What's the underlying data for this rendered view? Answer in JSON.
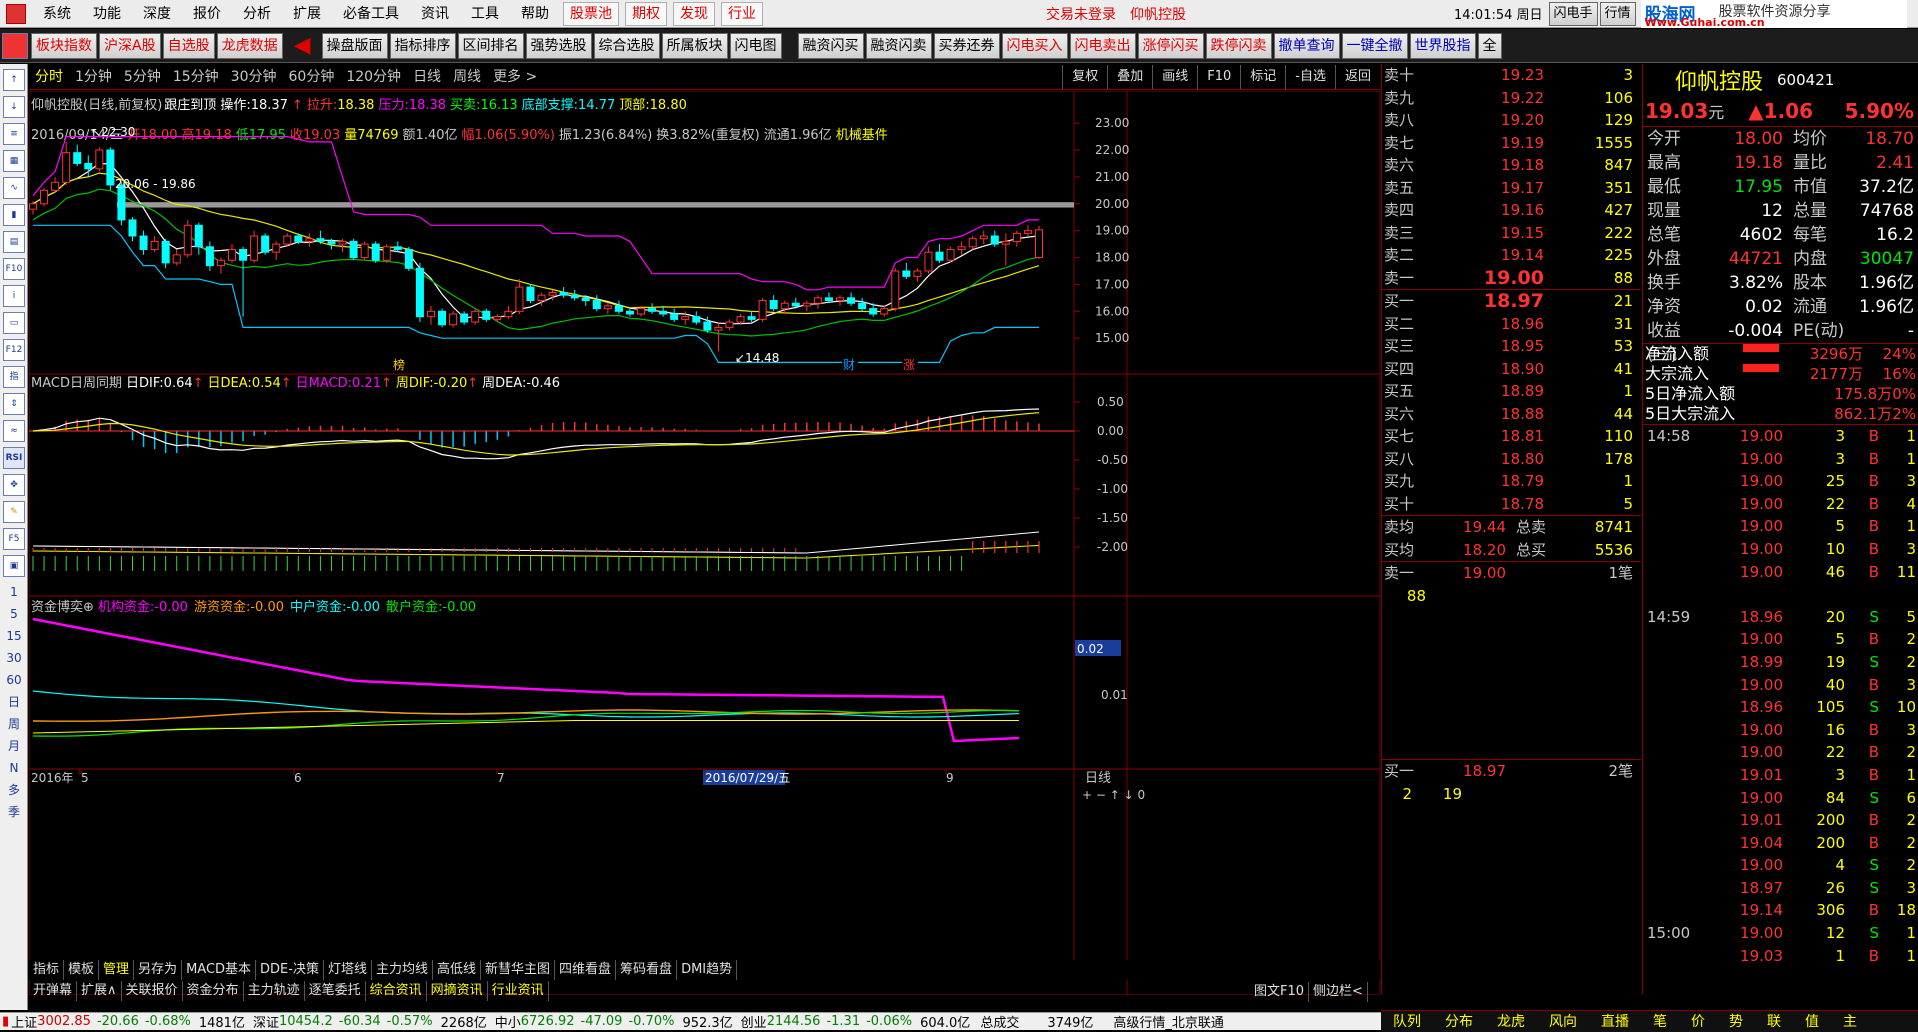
{
  "menu": {
    "items": [
      "系统",
      "功能",
      "深度",
      "报价",
      "分析",
      "扩展",
      "必备工具",
      "资讯",
      "工具",
      "帮助"
    ],
    "red_buttons": [
      "股票池",
      "期权",
      "发现",
      "行业"
    ],
    "login_status": "交易未登录",
    "stock_link": "仰帆控股",
    "time": "14:01:54 周日",
    "flash": "闪电手",
    "market": "行情",
    "brand": "股海网",
    "brand_sub": "股票软件资源分享",
    "brand_url": "Www.Guhai.com.cn"
  },
  "toolbar": {
    "left": [
      "板块指数",
      "沪深A股",
      "自选股",
      "龙虎数据"
    ],
    "mid": [
      "操盘版面",
      "指标排序",
      "区间排名",
      "强势选股",
      "综合选股",
      "所属板块",
      "闪电图"
    ],
    "right": [
      "融资闪买",
      "融资闪卖",
      "买券还券",
      "闪电买入",
      "闪电卖出",
      "涨停闪买",
      "跌停闪卖",
      "撤单查询",
      "一键全撤",
      "世界股指",
      "全"
    ]
  },
  "periods": [
    "分时",
    "1分钟",
    "5分钟",
    "15分钟",
    "30分钟",
    "60分钟",
    "120分钟",
    "日线",
    "周线",
    "更多 >"
  ],
  "chart_buttons": [
    "复权",
    "叠加",
    "画线",
    "F10",
    "标记",
    "-自选",
    "返回"
  ],
  "left_strip": [
    "1",
    "5",
    "15",
    "30",
    "60",
    "日",
    "周",
    "月",
    "N",
    "多",
    "季"
  ],
  "kline": {
    "title_name": "仰帆控股",
    "title_mode": "(日线,前复权)",
    "follow": "跟庄到顶",
    "op_label": "操作:",
    "op_val": "18.37",
    "pull_label": "拉升:",
    "pull_val": "18.38",
    "press_label": "压力:",
    "press_val": "18.38",
    "buy_label": "买卖:",
    "buy_val": "16.13",
    "base_label": "底部支撑:",
    "base_val": "14.77",
    "top_label": "顶部:",
    "top_val": "18.80",
    "info_date": "2016/09/14/三",
    "info_open": "开18.00",
    "info_high": "高19.18",
    "info_low": "低17.95",
    "info_close": "收19.03",
    "info_vol": "量74769",
    "info_amt": "额1.40亿",
    "info_chg": "幅1.06(5.90%)",
    "info_amp": "振1.23(6.84%)",
    "info_turn": "换3.82%(重复权)",
    "info_float": "流通1.96亿",
    "info_sector": "机械基件",
    "high_mark": "22.30",
    "low_mark": "14.48",
    "gap_mark": "20.06 - 19.86",
    "yticks": [
      "23.00",
      "22.00",
      "21.00",
      "20.00",
      "19.00",
      "18.00",
      "17.00",
      "16.00",
      "15.00"
    ],
    "event_marks": [
      "榜",
      "财",
      "涨"
    ]
  },
  "macd": {
    "title": "MACD日周同期",
    "dif_label": "日DIF:",
    "dif": "0.64",
    "dea_label": "日DEA:",
    "dea": "0.54",
    "macd_label": "日MACD:",
    "macd": "0.21",
    "wdif_label": "周DIF:",
    "wdif": "-0.20",
    "wdea_label": "周DEA:",
    "wdea": "-0.46",
    "yticks": [
      "0.50",
      "0.00",
      "-0.50",
      "-1.00",
      "-1.50",
      "-2.00"
    ]
  },
  "fund": {
    "title": "资金博奕",
    "inst_label": "机构资金:",
    "inst": "-0.00",
    "hot_label": "游资资金:",
    "hot": "-0.00",
    "mid_label": "中户资金:",
    "mid": "-0.00",
    "retail_label": "散户资金:",
    "retail": "-0.00",
    "yticks": [
      "0.02",
      "0.01"
    ]
  },
  "xaxis": {
    "labels": [
      "2016年",
      "5",
      "6",
      "7",
      "2016/07/29/五",
      "9"
    ],
    "period": "日线"
  },
  "bottom_tabs": [
    "指标",
    "模板",
    "管理",
    "另存为",
    "MACD基本",
    "DDE-决策",
    "灯塔线",
    "主力均线",
    "高低线",
    "新彗华主图",
    "四维看盘",
    "筹码看盘",
    "DMI趋势"
  ],
  "bottom_tabs2": [
    "开弹幕",
    "扩展∧",
    "关联报价",
    "资金分布",
    "主力轨迹",
    "逐笔委托",
    "综合资讯",
    "网摘资讯",
    "行业资讯"
  ],
  "bottom_right": [
    "图文F10",
    "侧边栏<"
  ],
  "order_book": {
    "sells": [
      [
        "卖十",
        "19.23",
        "3"
      ],
      [
        "卖九",
        "19.22",
        "106"
      ],
      [
        "卖八",
        "19.20",
        "129"
      ],
      [
        "卖七",
        "19.19",
        "1555"
      ],
      [
        "卖六",
        "19.18",
        "847"
      ],
      [
        "卖五",
        "19.17",
        "351"
      ],
      [
        "卖四",
        "19.16",
        "427"
      ],
      [
        "卖三",
        "19.15",
        "222"
      ],
      [
        "卖二",
        "19.14",
        "225"
      ],
      [
        "卖一",
        "19.00",
        "88"
      ]
    ],
    "buys": [
      [
        "买一",
        "18.97",
        "21"
      ],
      [
        "买二",
        "18.96",
        "31"
      ],
      [
        "买三",
        "18.95",
        "53"
      ],
      [
        "买四",
        "18.90",
        "41"
      ],
      [
        "买五",
        "18.89",
        "1"
      ],
      [
        "买六",
        "18.88",
        "44"
      ],
      [
        "买七",
        "18.81",
        "110"
      ],
      [
        "买八",
        "18.80",
        "178"
      ],
      [
        "买九",
        "18.79",
        "1"
      ],
      [
        "买十",
        "18.78",
        "5"
      ]
    ],
    "avg_sell_label": "卖均",
    "avg_sell": "19.44",
    "total_sell_label": "总卖",
    "total_sell": "8741",
    "avg_buy_label": "买均",
    "avg_buy": "18.20",
    "total_buy_label": "总买",
    "total_buy": "5536",
    "s1_label": "卖一",
    "s1_price": "19.00",
    "s1_count": "1笔",
    "s1_vol": "88",
    "b1_label": "买一",
    "b1_price": "18.97",
    "b1_count": "2笔",
    "b1_a": "2",
    "b1_b": "19"
  },
  "stock": {
    "name": "仰帆控股",
    "code": "600421",
    "price": "19.03",
    "unit": "元",
    "change": "▲1.06",
    "pct": "5.90%",
    "stats": [
      [
        "今开",
        "18.00",
        "均价",
        "18.70"
      ],
      [
        "最高",
        "19.18",
        "量比",
        "2.41"
      ],
      [
        "最低",
        "17.95",
        "市值",
        "37.2亿"
      ],
      [
        "现量",
        "12",
        "总量",
        "74768"
      ],
      [
        "总笔",
        "4602",
        "每笔",
        "16.2"
      ],
      [
        "外盘",
        "44721",
        "内盘",
        "30047"
      ],
      [
        "换手",
        "3.82%",
        "股本",
        "1.96亿"
      ],
      [
        "净资",
        "0.02",
        "流通",
        "1.96亿"
      ],
      [
        "收益(三)",
        "-0.004",
        "PE(动)",
        "-"
      ]
    ],
    "flows": [
      [
        "净流入额",
        "3296万",
        "24%"
      ],
      [
        "大宗流入",
        "2177万",
        "16%"
      ],
      [
        "5日净流入额",
        "175.8万",
        "0%"
      ],
      [
        "5日大宗流入",
        "862.1万",
        "2%"
      ]
    ]
  },
  "ticks": [
    [
      "14:58",
      "19.00",
      "3",
      "B",
      "1"
    ],
    [
      "",
      "19.00",
      "3",
      "B",
      "1"
    ],
    [
      "",
      "19.00",
      "25",
      "B",
      "3"
    ],
    [
      "",
      "19.00",
      "22",
      "B",
      "4"
    ],
    [
      "",
      "19.00",
      "5",
      "B",
      "1"
    ],
    [
      "",
      "19.00",
      "10",
      "B",
      "3"
    ],
    [
      "",
      "19.00",
      "46",
      "B",
      "11"
    ],
    [
      "",
      "",
      " ",
      "",
      ""
    ],
    [
      "14:59",
      "18.96",
      "20",
      "S",
      "5"
    ],
    [
      "",
      "19.00",
      "5",
      "B",
      "2"
    ],
    [
      "",
      "18.99",
      "19",
      "S",
      "2"
    ],
    [
      "",
      "19.00",
      "40",
      "B",
      "3"
    ],
    [
      "",
      "18.96",
      "105",
      "S",
      "10"
    ],
    [
      "",
      "19.00",
      "16",
      "B",
      "3"
    ],
    [
      "",
      "19.00",
      "22",
      "B",
      "2"
    ],
    [
      "",
      "19.01",
      "3",
      "B",
      "1"
    ],
    [
      "",
      "19.00",
      "84",
      "S",
      "6"
    ],
    [
      "",
      "19.01",
      "200",
      "B",
      "2"
    ],
    [
      "",
      "19.04",
      "200",
      "B",
      "2"
    ],
    [
      "",
      "19.00",
      "4",
      "S",
      "2"
    ],
    [
      "",
      "18.97",
      "26",
      "S",
      "3"
    ],
    [
      "",
      "19.14",
      "306",
      "B",
      "18"
    ],
    [
      "15:00",
      "19.00",
      "12",
      "S",
      "1"
    ],
    [
      "",
      "19.03",
      "1",
      "B",
      "1"
    ]
  ],
  "right_tabs": [
    "队列",
    "分布",
    "龙虎",
    "风向",
    "直播",
    "笔",
    "价",
    "势",
    "联",
    "值",
    "主"
  ],
  "statusbar": {
    "sh_label": "上证",
    "sh": "3002.85",
    "sh_chg": "-20.66",
    "sh_pct": "-0.68%",
    "sh_amt": "1481亿",
    "sz_label": "深证",
    "sz": "10454.2",
    "sz_chg": "-60.34",
    "sz_pct": "-0.57%",
    "sz_amt": "2268亿",
    "zx_label": "中小",
    "zx": "6726.92",
    "zx_chg": "-47.09",
    "zx_pct": "-0.70%",
    "zx_amt": "952.3亿",
    "cy_label": "创业",
    "cy": "2144.56",
    "cy_chg": "-1.31",
    "cy_pct": "-0.06%",
    "cy_amt": "604.0亿",
    "total_label": "总成交",
    "total": "3749亿",
    "feed": "高级行情_北京联通"
  },
  "chart_data": {
    "type": "candlestick",
    "title": "仰帆控股",
    "ylim": [
      14.3,
      23.6
    ],
    "candles": [
      [
        19.8,
        20.1,
        19.6,
        20.0
      ],
      [
        20.0,
        20.6,
        19.9,
        20.5
      ],
      [
        20.5,
        21.0,
        20.4,
        20.8
      ],
      [
        20.8,
        22.3,
        20.7,
        21.9
      ],
      [
        21.9,
        22.2,
        21.4,
        21.5
      ],
      [
        21.5,
        21.8,
        21.0,
        21.3
      ],
      [
        21.3,
        22.1,
        21.2,
        22.0
      ],
      [
        22.0,
        22.1,
        20.5,
        20.7
      ],
      [
        20.7,
        20.8,
        19.2,
        19.4
      ],
      [
        19.4,
        19.5,
        18.6,
        18.8
      ],
      [
        18.8,
        19.0,
        18.1,
        18.3
      ],
      [
        18.3,
        18.8,
        18.2,
        18.6
      ],
      [
        18.6,
        18.7,
        17.6,
        17.8
      ],
      [
        17.8,
        18.3,
        17.7,
        18.1
      ],
      [
        18.1,
        19.4,
        18.0,
        19.2
      ],
      [
        19.2,
        19.3,
        18.1,
        18.4
      ],
      [
        18.4,
        18.6,
        17.5,
        17.7
      ],
      [
        17.7,
        18.0,
        17.4,
        17.9
      ],
      [
        17.9,
        18.5,
        17.8,
        18.3
      ],
      [
        18.3,
        18.4,
        15.8,
        17.9
      ],
      [
        17.9,
        19.0,
        17.8,
        18.8
      ],
      [
        18.8,
        18.9,
        18.1,
        18.2
      ],
      [
        18.2,
        18.6,
        17.9,
        18.5
      ],
      [
        18.5,
        18.9,
        18.4,
        18.8
      ],
      [
        18.8,
        18.9,
        18.5,
        18.6
      ],
      [
        18.6,
        18.9,
        18.4,
        18.7
      ],
      [
        18.7,
        19.0,
        18.5,
        18.6
      ],
      [
        18.6,
        18.7,
        18.3,
        18.5
      ],
      [
        18.5,
        18.7,
        18.2,
        18.6
      ],
      [
        18.6,
        18.7,
        17.9,
        18.0
      ],
      [
        18.0,
        18.6,
        17.9,
        18.5
      ],
      [
        18.5,
        18.6,
        17.8,
        17.9
      ],
      [
        17.9,
        18.5,
        17.8,
        18.4
      ],
      [
        18.4,
        18.6,
        18.2,
        18.3
      ],
      [
        18.3,
        18.4,
        17.5,
        17.6
      ],
      [
        17.6,
        17.8,
        15.6,
        15.8
      ],
      [
        15.8,
        16.2,
        15.5,
        16.0
      ],
      [
        16.0,
        16.1,
        15.4,
        15.5
      ],
      [
        15.5,
        16.0,
        15.4,
        15.9
      ],
      [
        15.9,
        16.0,
        15.5,
        15.6
      ],
      [
        15.6,
        16.1,
        15.5,
        16.0
      ],
      [
        16.0,
        16.1,
        15.6,
        15.7
      ],
      [
        15.7,
        15.9,
        15.6,
        15.8
      ],
      [
        15.8,
        16.2,
        15.7,
        16.0
      ],
      [
        16.0,
        17.2,
        15.9,
        16.9
      ],
      [
        16.9,
        17.0,
        16.3,
        16.4
      ],
      [
        16.4,
        16.7,
        16.2,
        16.6
      ],
      [
        16.6,
        16.8,
        16.4,
        16.7
      ],
      [
        16.7,
        16.9,
        16.5,
        16.6
      ],
      [
        16.6,
        16.8,
        16.4,
        16.5
      ],
      [
        16.5,
        16.6,
        16.2,
        16.4
      ],
      [
        16.4,
        16.6,
        16.0,
        16.1
      ],
      [
        16.1,
        16.3,
        15.9,
        16.2
      ],
      [
        16.2,
        16.4,
        15.9,
        16.0
      ],
      [
        16.0,
        16.1,
        15.8,
        15.9
      ],
      [
        15.9,
        16.2,
        15.8,
        16.1
      ],
      [
        16.1,
        16.3,
        15.9,
        16.0
      ],
      [
        16.0,
        16.2,
        15.8,
        15.9
      ],
      [
        15.9,
        16.1,
        15.6,
        15.7
      ],
      [
        15.7,
        16.0,
        15.5,
        15.8
      ],
      [
        15.8,
        16.0,
        15.5,
        15.6
      ],
      [
        15.6,
        15.8,
        15.2,
        15.3
      ],
      [
        15.3,
        15.6,
        14.5,
        15.4
      ],
      [
        15.4,
        15.7,
        15.3,
        15.6
      ],
      [
        15.6,
        15.9,
        15.5,
        15.8
      ],
      [
        15.8,
        16.0,
        15.6,
        15.7
      ],
      [
        15.7,
        16.5,
        15.6,
        16.4
      ],
      [
        16.4,
        16.6,
        16.0,
        16.1
      ],
      [
        16.1,
        16.4,
        15.9,
        16.3
      ],
      [
        16.3,
        16.5,
        16.1,
        16.2
      ],
      [
        16.2,
        16.4,
        16.0,
        16.3
      ],
      [
        16.3,
        16.6,
        16.1,
        16.5
      ],
      [
        16.5,
        16.7,
        16.3,
        16.4
      ],
      [
        16.4,
        16.6,
        16.2,
        16.5
      ],
      [
        16.5,
        16.7,
        16.2,
        16.3
      ],
      [
        16.3,
        16.5,
        16.0,
        16.1
      ],
      [
        16.1,
        16.3,
        15.8,
        15.9
      ],
      [
        15.9,
        16.2,
        15.8,
        16.1
      ],
      [
        16.1,
        17.6,
        16.0,
        17.5
      ],
      [
        17.5,
        17.8,
        17.2,
        17.3
      ],
      [
        17.3,
        17.6,
        17.1,
        17.5
      ],
      [
        17.5,
        18.4,
        17.4,
        18.2
      ],
      [
        18.2,
        18.5,
        17.8,
        17.9
      ],
      [
        17.9,
        18.4,
        17.8,
        18.3
      ],
      [
        18.3,
        18.6,
        18.1,
        18.4
      ],
      [
        18.4,
        18.8,
        18.3,
        18.7
      ],
      [
        18.7,
        19.0,
        18.5,
        18.8
      ],
      [
        18.8,
        19.0,
        18.4,
        18.5
      ],
      [
        18.5,
        18.9,
        17.7,
        18.6
      ],
      [
        18.6,
        19.0,
        18.4,
        18.9
      ],
      [
        18.9,
        19.2,
        18.8,
        19.0
      ],
      [
        18.0,
        19.18,
        17.95,
        19.03
      ]
    ]
  }
}
